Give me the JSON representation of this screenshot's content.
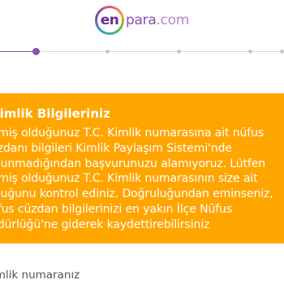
{
  "logo": {
    "en": "en",
    "para": "para",
    "com": ".com",
    "colors": {
      "primary": "#6a2c91",
      "secondary": "#8a4fb3",
      "light": "#b784d4"
    }
  },
  "progress": {
    "current_step": 1,
    "total_steps": 5,
    "active_color": "#8a4fb3",
    "inactive_color": "#c9c9c9"
  },
  "alert": {
    "background": "#ffa500",
    "title": "Kimlik Bilgileriniz",
    "lines": [
      "irmiş olduğunuz T.C. Kimlik numarasına ait nüfus",
      "üzdanı bilgileri Kimlik Paylaşım Sistemi'nde",
      "ulunmadığından başvurunuzu alamıyoruz. Lütfen",
      "irmiş olduğunuz T.C. Kimlik numarasının size ait",
      "lduğunu kontrol ediniz. Doğruluğundan eminseniz,",
      "üfus cüzdan bilgilerinizi en yakın İlçe Nüfus",
      "üdürlüğü'ne giderek kaydettirebilirsiniz"
    ]
  },
  "form": {
    "id_label": "imlik numaranız"
  }
}
